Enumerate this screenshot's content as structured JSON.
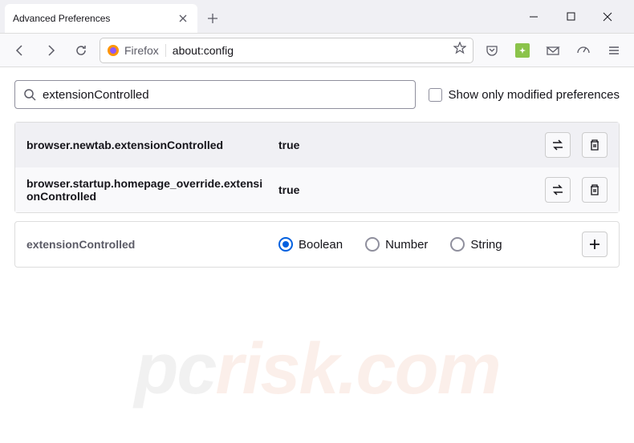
{
  "tab": {
    "title": "Advanced Preferences"
  },
  "urlbar": {
    "identity_label": "Firefox",
    "url": "about:config"
  },
  "search": {
    "value": "extensionControlled",
    "checkbox_label": "Show only modified preferences"
  },
  "results": [
    {
      "name": "browser.newtab.extensionControlled",
      "value": "true"
    },
    {
      "name": "browser.startup.homepage_override.extensionControlled",
      "value": "true"
    }
  ],
  "add": {
    "name": "extensionControlled",
    "options": [
      "Boolean",
      "Number",
      "String"
    ],
    "selected": "Boolean"
  },
  "watermark": {
    "prefix": "pc",
    "suffix": "risk.com"
  }
}
